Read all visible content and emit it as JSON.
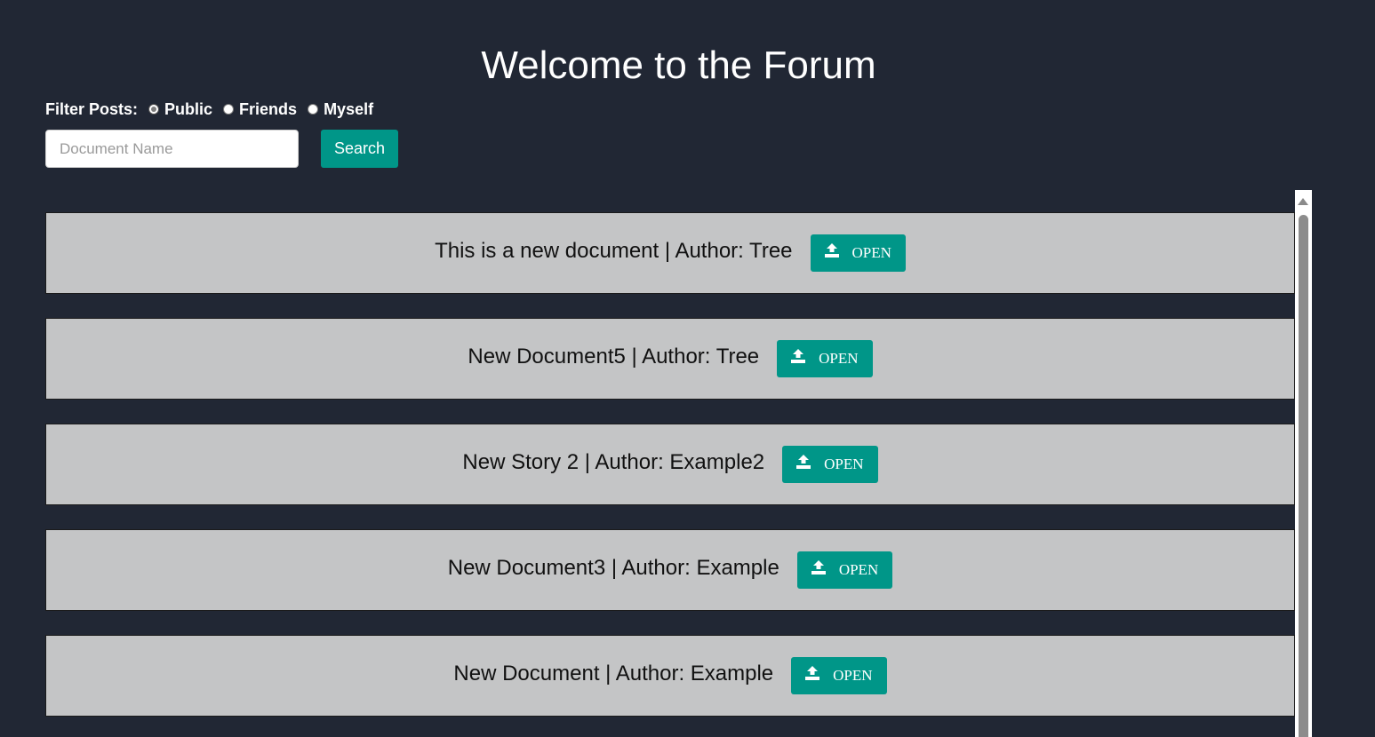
{
  "header": {
    "title": "Welcome to the Forum"
  },
  "filter": {
    "label": "Filter Posts:",
    "options": [
      {
        "label": "Public",
        "selected": true
      },
      {
        "label": "Friends",
        "selected": false
      },
      {
        "label": "Myself",
        "selected": false
      }
    ]
  },
  "search": {
    "placeholder": "Document Name",
    "value": "",
    "button_label": "Search"
  },
  "documents": [
    {
      "text": "This is a new document | Author: Tree",
      "button_label": "OPEN",
      "button_icon": "upload-icon"
    },
    {
      "text": "New Document5 | Author: Tree",
      "button_label": "OPEN",
      "button_icon": "upload-icon"
    },
    {
      "text": "New Story 2 | Author: Example2",
      "button_label": "OPEN",
      "button_icon": "upload-icon"
    },
    {
      "text": "New Document3 | Author: Example",
      "button_label": "OPEN",
      "button_icon": "upload-icon"
    },
    {
      "text": "New Document | Author: Example",
      "button_label": "OPEN",
      "button_icon": "upload-icon"
    }
  ],
  "colors": {
    "background": "#212734",
    "accent": "#009688",
    "card": "#c4c5c6"
  }
}
